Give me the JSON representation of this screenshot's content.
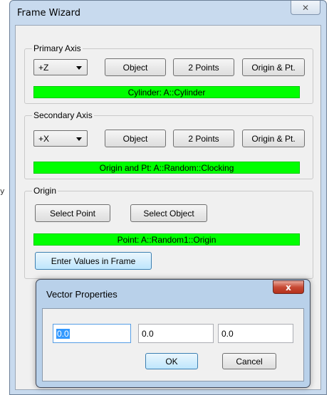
{
  "stray_char": "y",
  "frame_wizard": {
    "title": "Frame Wizard",
    "close_glyph": "✕",
    "primary": {
      "label": "Primary Axis",
      "axis": "+Z",
      "buttons": [
        "Object",
        "2 Points",
        "Origin & Pt."
      ],
      "status": "Cylinder: A::Cylinder"
    },
    "secondary": {
      "label": "Secondary Axis",
      "axis": "+X",
      "buttons": [
        "Object",
        "2 Points",
        "Origin & Pt."
      ],
      "status": "Origin and Pt: A::Random::Clocking"
    },
    "origin": {
      "label": "Origin",
      "select_point": "Select Point",
      "select_object": "Select Object",
      "status": "Point: A::Random1::Origin",
      "enter_values": "Enter Values in Frame"
    }
  },
  "vector_properties": {
    "title": "Vector Properties",
    "close_glyph": "x",
    "values": [
      "0.0",
      "0.0",
      "0.0"
    ],
    "ok": "OK",
    "cancel": "Cancel"
  },
  "colors": {
    "status_green": "#00ff00",
    "window_frame": "#c8daee",
    "dialog_frame": "#b9d1ea",
    "close_red": "#c74a35"
  }
}
